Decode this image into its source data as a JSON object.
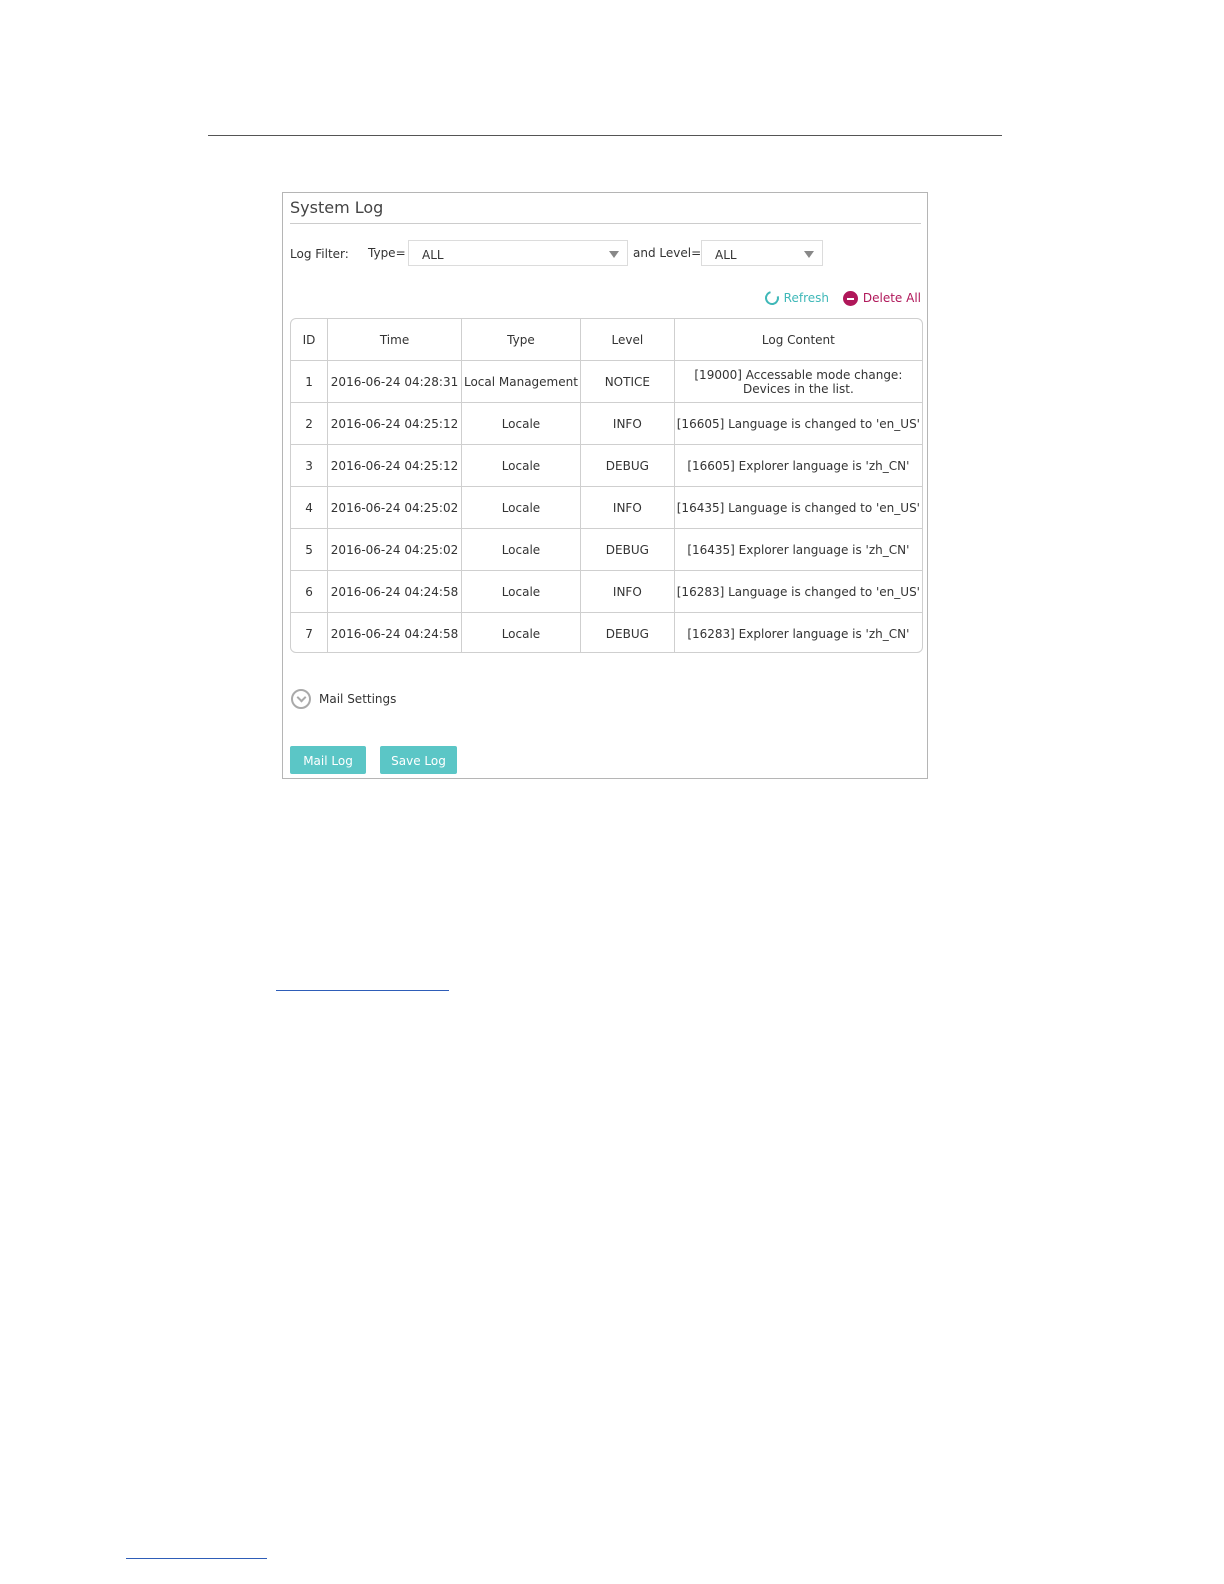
{
  "panel": {
    "title": "System Log",
    "filter_label": "Log Filter:",
    "type_label": "Type=",
    "type_value": "ALL",
    "level_label": "and Level=",
    "level_value": "ALL",
    "refresh_label": "Refresh",
    "delete_all_label": "Delete All"
  },
  "table": {
    "headers": [
      "ID",
      "Time",
      "Type",
      "Level",
      "Log Content"
    ],
    "rows": [
      [
        "1",
        "2016-06-24 04:28:31",
        "Local Management",
        "NOTICE",
        "[19000] Accessable mode change: Devices in the list."
      ],
      [
        "2",
        "2016-06-24 04:25:12",
        "Locale",
        "INFO",
        "[16605] Language is changed to 'en_US'"
      ],
      [
        "3",
        "2016-06-24 04:25:12",
        "Locale",
        "DEBUG",
        "[16605] Explorer language is 'zh_CN'"
      ],
      [
        "4",
        "2016-06-24 04:25:02",
        "Locale",
        "INFO",
        "[16435] Language is changed to 'en_US'"
      ],
      [
        "5",
        "2016-06-24 04:25:02",
        "Locale",
        "DEBUG",
        "[16435] Explorer language is 'zh_CN'"
      ],
      [
        "6",
        "2016-06-24 04:24:58",
        "Locale",
        "INFO",
        "[16283] Language is changed to 'en_US'"
      ],
      [
        "7",
        "2016-06-24 04:24:58",
        "Locale",
        "DEBUG",
        "[16283] Explorer language is 'zh_CN'"
      ]
    ]
  },
  "mail_settings_label": "Mail Settings",
  "buttons": {
    "mail_log": "Mail Log",
    "save_log": "Save Log"
  },
  "colors": {
    "accent": "#5bc6c6",
    "refresh": "#3fb8b8",
    "delete": "#b0175a"
  }
}
